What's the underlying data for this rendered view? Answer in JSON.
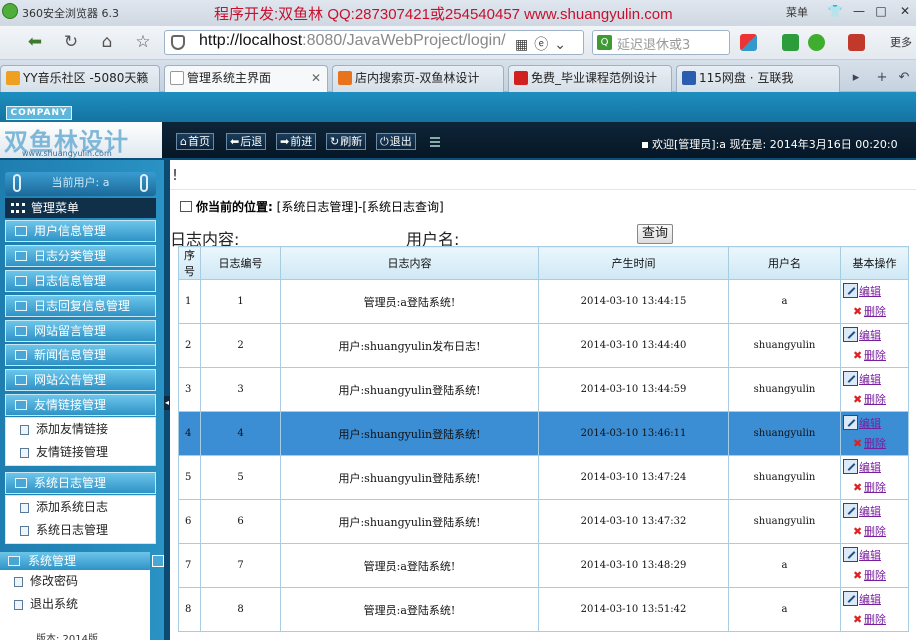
{
  "browser": {
    "app_name": "360安全浏览器 6.3",
    "watermark_title": "程序开发:双鱼林 QQ:287307421或254540457 www.shuangyulin.com",
    "menu_label": "菜单",
    "url_host": "http://localhost",
    "url_path": ":8080/JavaWebProject/login/",
    "search_placeholder": "延迟退休或3",
    "more_label": "更多",
    "tabs": [
      {
        "label": "YY音乐社区 -5080天籁",
        "favicon_color": "#f0a020"
      },
      {
        "label": "管理系统主界面",
        "favicon_color": "#ffffff"
      },
      {
        "label": "店内搜索页-双鱼林设计",
        "favicon_color": "#e8731e"
      },
      {
        "label": "免费_毕业课程范例设计",
        "favicon_color": "#d22020"
      },
      {
        "label": "115网盘 · 互联我",
        "favicon_color": "#2a5fb0"
      }
    ]
  },
  "header": {
    "company_badge": "COMPANY",
    "logo_text": "双鱼林设计",
    "logo_url": "www.shuangyulin.com",
    "buttons": [
      {
        "icon": "⌂",
        "label": "首页"
      },
      {
        "icon": "⬅",
        "label": "后退"
      },
      {
        "icon": "➡",
        "label": "前进"
      },
      {
        "icon": "↻",
        "label": "刷新"
      },
      {
        "icon": "⏻",
        "label": "退出"
      }
    ],
    "welcome": "欢迎[管理员]:a  现在是: 2014年3月16日 00:20:0"
  },
  "sidebar": {
    "current_user": "当前用户: a",
    "menu_title": "管理菜单",
    "items": [
      "用户信息管理",
      "日志分类管理",
      "日志信息管理",
      "日志回复信息管理",
      "网站留言管理",
      "新闻信息管理",
      "网站公告管理",
      "友情链接管理"
    ],
    "friend_link_sub": [
      "添加友情链接",
      "友情链接管理"
    ],
    "syslog_title": "系统日志管理",
    "syslog_sub": [
      "添加系统日志",
      "系统日志管理"
    ],
    "system_title": "系统管理",
    "system_sub": [
      "修改密码",
      "退出系统"
    ],
    "bottom_text": "版本: 2014版 ..."
  },
  "content": {
    "top_mark": "!",
    "position_label": "你当前的位置:",
    "position_path": "[系统日志管理]-[系统日志查询]",
    "filter": {
      "content_label": "日志内容:",
      "user_label": "用户名:",
      "query_button": "查询"
    },
    "columns": [
      "序号",
      "日志编号",
      "日志内容",
      "产生时间",
      "用户名",
      "基本操作"
    ],
    "edit_label": "编辑",
    "delete_label": "删除",
    "selected_row": 3,
    "rows": [
      {
        "seq": "1",
        "id": "1",
        "content": "管理员:a登陆系统!",
        "time": "2014-03-10 13:44:15",
        "user": "a"
      },
      {
        "seq": "2",
        "id": "2",
        "content": "用户:shuangyulin发布日志!",
        "time": "2014-03-10 13:44:40",
        "user": "shuangyulin"
      },
      {
        "seq": "3",
        "id": "3",
        "content": "用户:shuangyulin登陆系统!",
        "time": "2014-03-10 13:44:59",
        "user": "shuangyulin"
      },
      {
        "seq": "4",
        "id": "4",
        "content": "用户:shuangyulin登陆系统!",
        "time": "2014-03-10 13:46:11",
        "user": "shuangyulin"
      },
      {
        "seq": "5",
        "id": "5",
        "content": "用户:shuangyulin登陆系统!",
        "time": "2014-03-10 13:47:24",
        "user": "shuangyulin"
      },
      {
        "seq": "6",
        "id": "6",
        "content": "用户:shuangyulin登陆系统!",
        "time": "2014-03-10 13:47:32",
        "user": "shuangyulin"
      },
      {
        "seq": "7",
        "id": "7",
        "content": "管理员:a登陆系统!",
        "time": "2014-03-10 13:48:29",
        "user": "a"
      },
      {
        "seq": "8",
        "id": "8",
        "content": "管理员:a登陆系统!",
        "time": "2014-03-10 13:51:42",
        "user": "a"
      }
    ]
  }
}
